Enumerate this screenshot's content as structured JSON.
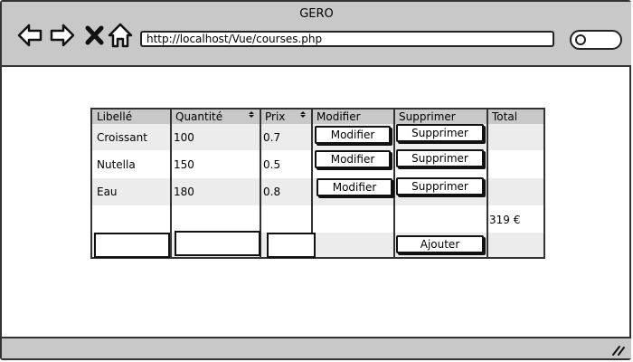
{
  "window": {
    "title": "GERO"
  },
  "address_bar": {
    "url": "http://localhost/Vue/courses.php"
  },
  "icons": {
    "back": "arrow-left-icon",
    "forward": "arrow-right-icon",
    "close": "close-icon",
    "home": "home-icon",
    "search": "search-icon",
    "resize": "resize-grip-icon"
  },
  "table": {
    "headers": [
      "Libellé",
      "Quantité",
      "Prix",
      "Modifier",
      "Supprimer",
      "Total"
    ],
    "rows": [
      {
        "libelle": "Croissant",
        "quantite": "100",
        "prix": "0.7",
        "modifier": "Modifier",
        "supprimer": "Supprimer"
      },
      {
        "libelle": "Nutella",
        "quantite": "150",
        "prix": "0.5",
        "modifier": "Modifier",
        "supprimer": "Supprimer"
      },
      {
        "libelle": "Eau",
        "quantite": "180",
        "prix": "0.8",
        "modifier": "Modifier",
        "supprimer": "Supprimer"
      }
    ],
    "total": "319 €",
    "add_button": "Ajouter"
  }
}
